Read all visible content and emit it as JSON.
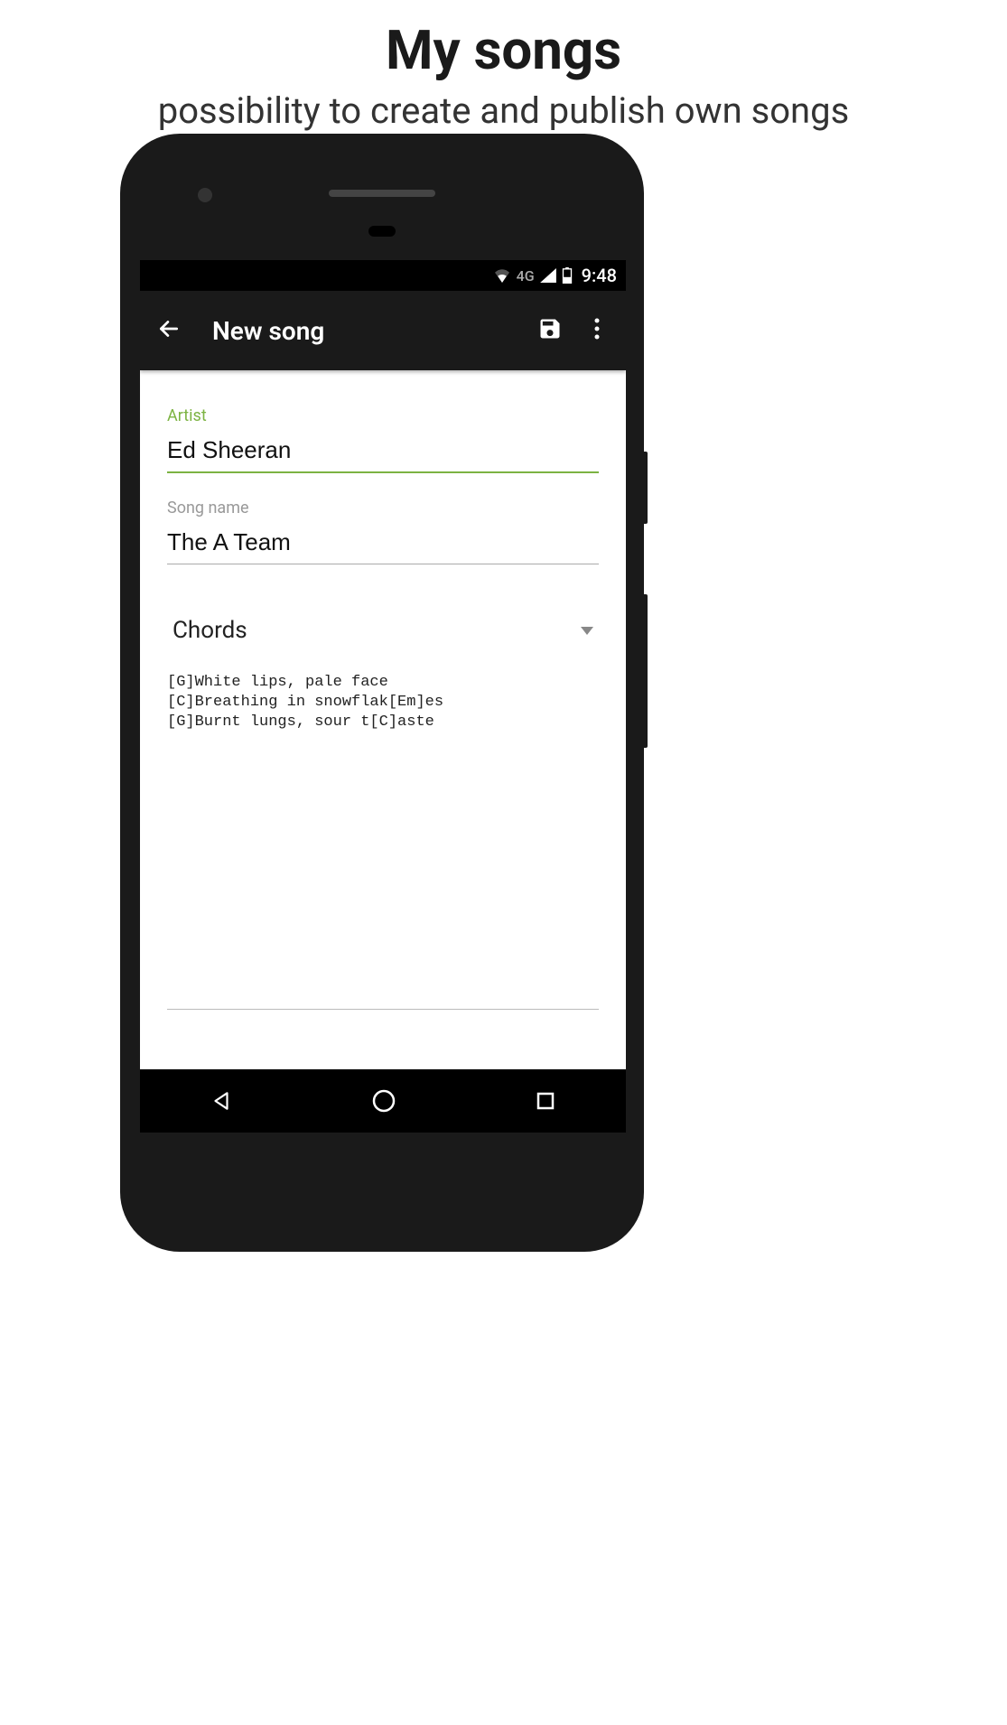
{
  "header": {
    "title": "My songs",
    "subtitle": "possibility to create and publish own songs"
  },
  "status_bar": {
    "network": "4G",
    "time": "9:48"
  },
  "app_bar": {
    "title": "New song"
  },
  "form": {
    "artist_label": "Artist",
    "artist_value": "Ed Sheeran",
    "song_label": "Song name",
    "song_value": "The A Team",
    "type_value": "Chords",
    "lyrics": "[G]White lips, pale face\n[C]Breathing in snowflak[Em]es\n[G]Burnt lungs, sour t[C]aste"
  }
}
